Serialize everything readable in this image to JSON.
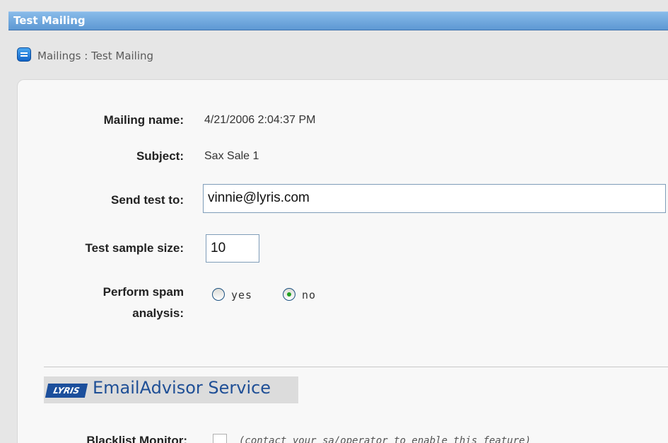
{
  "window": {
    "title": "Test Mailing"
  },
  "breadcrumb": {
    "text": "Mailings : Test Mailing",
    "icon": "mailing-icon"
  },
  "form": {
    "mailing_name_label": "Mailing name:",
    "mailing_name_value": "4/21/2006 2:04:37 PM",
    "subject_label": "Subject:",
    "subject_value": "Sax Sale 1",
    "send_test_label": "Send test to:",
    "send_test_value": "vinnie@lyris.com",
    "sample_size_label": "Test sample size:",
    "sample_size_value": "10",
    "spam_label_line1": "Perform spam",
    "spam_label_line2": "analysis:",
    "spam_options": [
      {
        "label": "yes",
        "selected": false
      },
      {
        "label": "no",
        "selected": true
      }
    ]
  },
  "email_advisor": {
    "logo_text": "LYRIS",
    "title": "EmailAdvisor Service",
    "blacklist_label": "Blacklist Monitor:",
    "blacklist_note": "(contact your sa/operator to enable this feature)"
  },
  "colors": {
    "titlebar": "#5d98d3",
    "accent_blue": "#1f4f96",
    "radio_selected": "#21a121"
  }
}
